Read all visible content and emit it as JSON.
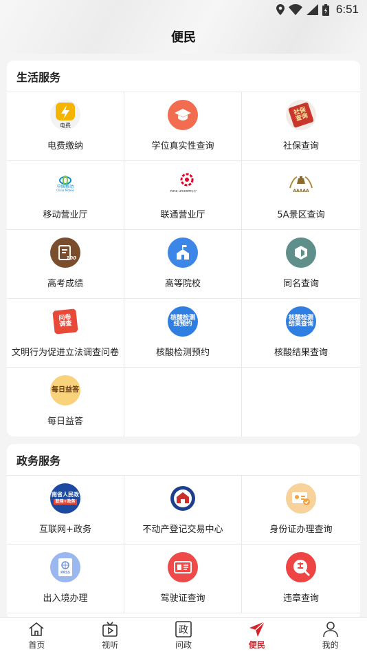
{
  "status_bar": {
    "time": "6:51"
  },
  "page_title": "便民",
  "life_services": {
    "title": "生活服务",
    "items": [
      {
        "label": "电费缴纳",
        "icon": "electricity-bill-icon"
      },
      {
        "label": "学位真实性查询",
        "icon": "graduation-cap-icon"
      },
      {
        "label": "社保查询",
        "icon": "social-security-icon"
      },
      {
        "label": "移动营业厅",
        "icon": "china-mobile-icon"
      },
      {
        "label": "联通营业厅",
        "icon": "china-unicom-icon"
      },
      {
        "label": "5A景区查询",
        "icon": "5a-scenic-icon"
      },
      {
        "label": "高考成绩",
        "icon": "exam-score-icon"
      },
      {
        "label": "高等院校",
        "icon": "university-icon"
      },
      {
        "label": "同名查询",
        "icon": "same-name-query-icon"
      },
      {
        "label": "文明行为促进立法调查问卷",
        "icon": "questionnaire-icon"
      },
      {
        "label": "核酸检测预约",
        "icon": "nucleic-test-appointment-icon"
      },
      {
        "label": "核酸结果查询",
        "icon": "nucleic-result-query-icon"
      },
      {
        "label": "每日益答",
        "icon": "daily-quiz-icon"
      }
    ]
  },
  "gov_services": {
    "title": "政务服务",
    "items": [
      {
        "label": "互联网+政务",
        "icon": "internet-gov-icon"
      },
      {
        "label": "不动产登记交易中心",
        "icon": "real-estate-registration-icon"
      },
      {
        "label": "身份证办理查询",
        "icon": "id-card-icon"
      },
      {
        "label": "出入境办理",
        "icon": "passport-icon"
      },
      {
        "label": "驾驶证查询",
        "icon": "driving-license-icon"
      },
      {
        "label": "违章查询",
        "icon": "traffic-violation-icon"
      }
    ]
  },
  "icon_text": {
    "electricity": "电费",
    "mobile_cn": "中国移动",
    "mobile_en": "China Mobile",
    "unicom": "China unicom中国联通",
    "5a": "AAAAA",
    "score": "100",
    "questionnaire_1": "问卷",
    "questionnaire_2": "调查",
    "nucleic1_1": "核酸检测",
    "nucleic1_2": "线预约",
    "nucleic2_1": "核酸检测",
    "nucleic2_2": "结果查询",
    "daily": "每日益答",
    "gov_1": "南省人民政",
    "gov_2": "联网+政务",
    "passport": "PASS",
    "social_1": "社保",
    "social_2": "查询"
  },
  "bottom_nav": [
    {
      "label": "首页",
      "icon": "home-icon"
    },
    {
      "label": "视听",
      "icon": "tv-icon"
    },
    {
      "label": "问政",
      "icon": "gov-qa-icon"
    },
    {
      "label": "便民",
      "icon": "service-arrow-icon"
    },
    {
      "label": "我的",
      "icon": "profile-icon"
    }
  ],
  "colors": {
    "accent": "#d6232c",
    "electricity": "#f5b400",
    "graduation": "#f26c4f",
    "exam": "#7a4e2d",
    "university": "#3c86e8",
    "samename": "#5e8f8b",
    "passport": "#9bb7f0",
    "license": "#ee4a4a",
    "violation": "#ee4444",
    "idcard": "#f7d29a"
  }
}
